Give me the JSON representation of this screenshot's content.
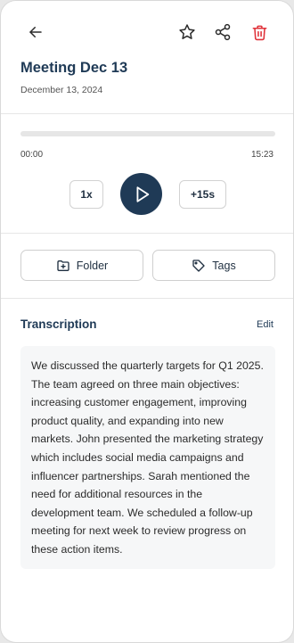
{
  "recording": {
    "title": "Meeting Dec 13",
    "date": "December 13, 2024"
  },
  "player": {
    "current_time": "00:00",
    "duration": "15:23",
    "progress_fraction": 0,
    "speed_label": "1x",
    "skip_label": "+15s"
  },
  "actions": {
    "folder_label": "Folder",
    "tags_label": "Tags"
  },
  "transcription": {
    "heading": "Transcription",
    "edit_label": "Edit",
    "text": "We discussed the quarterly targets for Q1 2025. The team agreed on three main objectives: increasing customer engagement, improving product quality, and expanding into new markets. John presented the marketing strategy which includes social media campaigns and influencer partnerships. Sarah mentioned the need for additional resources in the development team. We scheduled a follow-up meeting for next week to review progress on these action items."
  },
  "icons": {
    "back": "arrow-left-icon",
    "star": "star-icon",
    "share": "share-icon",
    "delete": "trash-icon",
    "play": "play-icon",
    "folder": "folder-plus-icon",
    "tag": "tag-icon"
  },
  "colors": {
    "primary": "#1f3a56",
    "delete": "#e0323a",
    "transcript_bg": "#f6f7f8"
  }
}
